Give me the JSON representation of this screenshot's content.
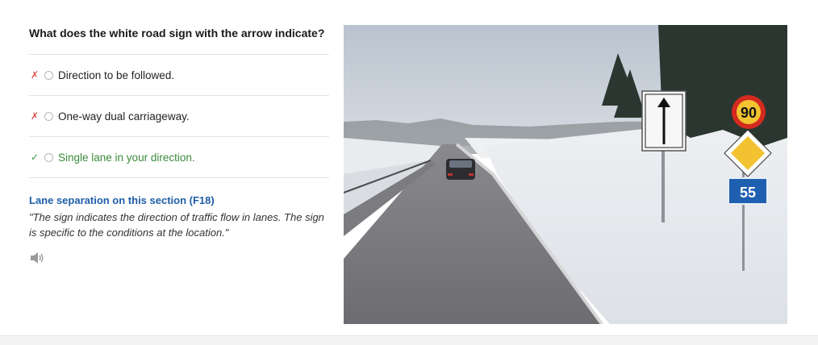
{
  "quiz": {
    "question": "What does the white road sign with the arrow indicate?",
    "answers": [
      {
        "label": "Direction to be followed.",
        "status": "wrong",
        "mark": "✗"
      },
      {
        "label": "One-way dual carriageway.",
        "status": "wrong",
        "mark": "✗"
      },
      {
        "label": "Single lane in your direction.",
        "status": "correct",
        "mark": "✓"
      }
    ],
    "explanation": {
      "title": "Lane separation on this section (F18)",
      "text": "\"The sign indicates the direction of traffic flow in lanes. The sign is specific to the conditions at the location.\""
    },
    "audio_icon": "speaker-icon"
  },
  "photo": {
    "speed_limit": "90",
    "route_number": "55"
  },
  "colors": {
    "wrong": "#d9534f",
    "correct": "#3a9a3a",
    "link": "#1f5ea8",
    "sign_blue": "#1f5fb0",
    "sign_red": "#d42a1f",
    "sign_yellow": "#f2c230"
  }
}
